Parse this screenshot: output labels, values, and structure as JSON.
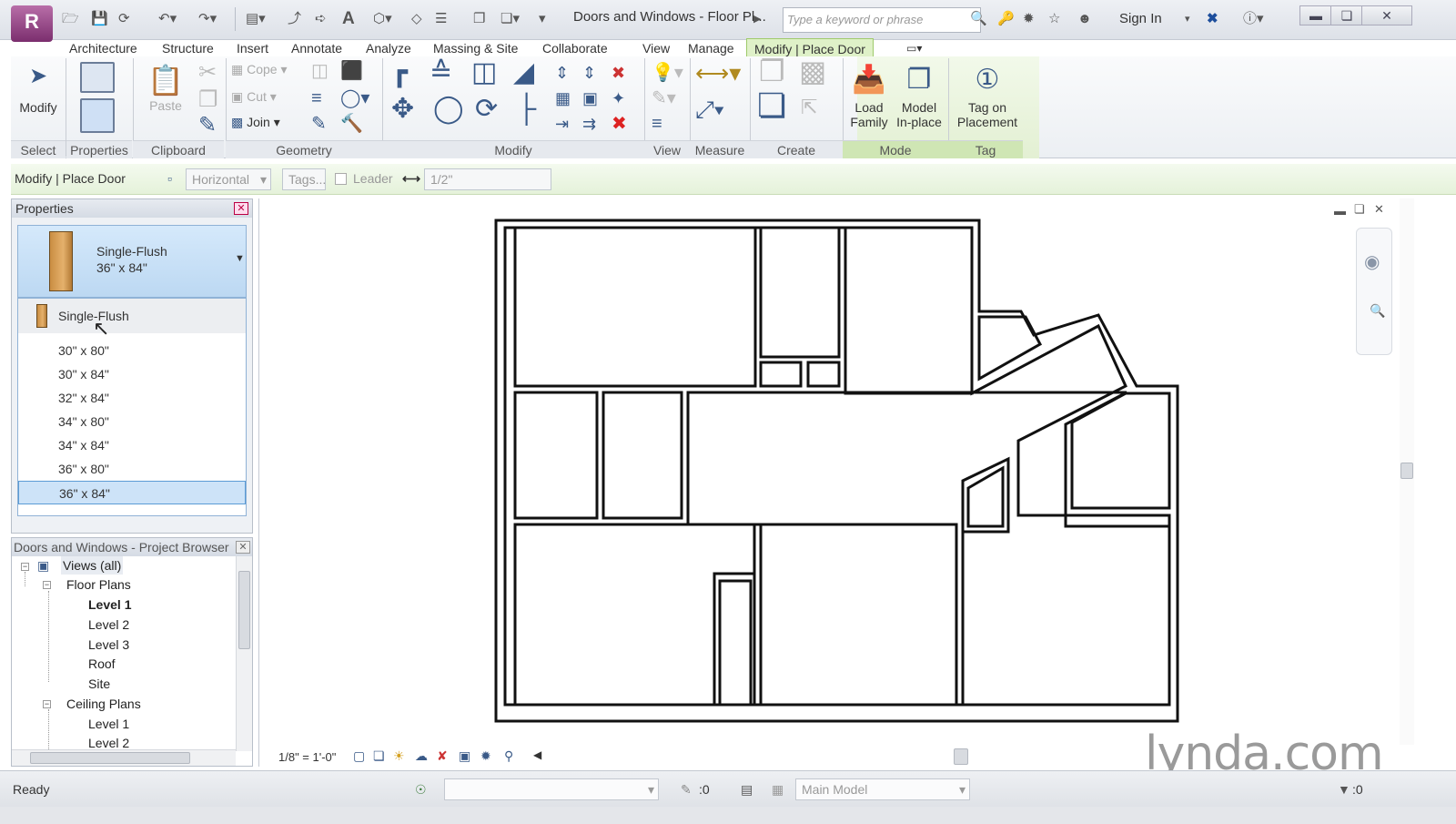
{
  "titlebar": {
    "app_letter": "R",
    "doc_title": "Doors and Windows - Floor Pl...",
    "search_placeholder": "Type a keyword or phrase",
    "sign_in": "Sign In"
  },
  "tabs": [
    "Architecture",
    "Structure",
    "Insert",
    "Annotate",
    "Analyze",
    "Massing & Site",
    "Collaborate",
    "View",
    "Manage",
    "Modify | Place Door"
  ],
  "ribbon": {
    "select": {
      "modify": "Modify",
      "label": "Select"
    },
    "properties": {
      "label": "Properties"
    },
    "clipboard": {
      "paste": "Paste",
      "label": "Clipboard"
    },
    "geometry": {
      "cope": "Cope",
      "cut": "Cut",
      "join": "Join",
      "label": "Geometry"
    },
    "modify_label": "Modify",
    "view_label": "View",
    "measure_label": "Measure",
    "create_label": "Create",
    "mode": {
      "load_family_1": "Load",
      "load_family_2": "Family",
      "model_inplace_1": "Model",
      "model_inplace_2": "In-place",
      "label": "Mode"
    },
    "tag": {
      "tag_on_1": "Tag on",
      "tag_on_2": "Placement",
      "label": "Tag"
    }
  },
  "options_bar": {
    "context": "Modify | Place Door",
    "orientation": "Horizontal",
    "tags": "Tags...",
    "leader": "Leader",
    "leader_length": "1/2\""
  },
  "properties": {
    "title": "Properties",
    "type_family": "Single-Flush",
    "type_size": "36\" x 84\"",
    "list": [
      {
        "label": "Single-Flush",
        "kind": "family"
      },
      {
        "label": "30\" x 80\"",
        "kind": "type"
      },
      {
        "label": "30\" x 84\"",
        "kind": "type"
      },
      {
        "label": "32\" x 84\"",
        "kind": "type"
      },
      {
        "label": "34\" x 80\"",
        "kind": "type"
      },
      {
        "label": "34\" x 84\"",
        "kind": "type"
      },
      {
        "label": "36\" x 80\"",
        "kind": "type"
      },
      {
        "label": "36\" x 84\"",
        "kind": "selected"
      }
    ]
  },
  "browser": {
    "title": "Doors and Windows - Project Browser",
    "views": "Views (all)",
    "floor_plans": "Floor Plans",
    "floor_items": [
      "Level 1",
      "Level 2",
      "Level 3",
      "Roof",
      "Site"
    ],
    "ceiling_plans": "Ceiling Plans",
    "ceiling_items": [
      "Level 1",
      "Level 2"
    ]
  },
  "view_control": {
    "scale": "1/8\" = 1'-0\""
  },
  "status": {
    "ready": "Ready",
    "count": ":0",
    "model": "Main Model",
    "filter": ":0"
  },
  "watermark": "lynda.com"
}
